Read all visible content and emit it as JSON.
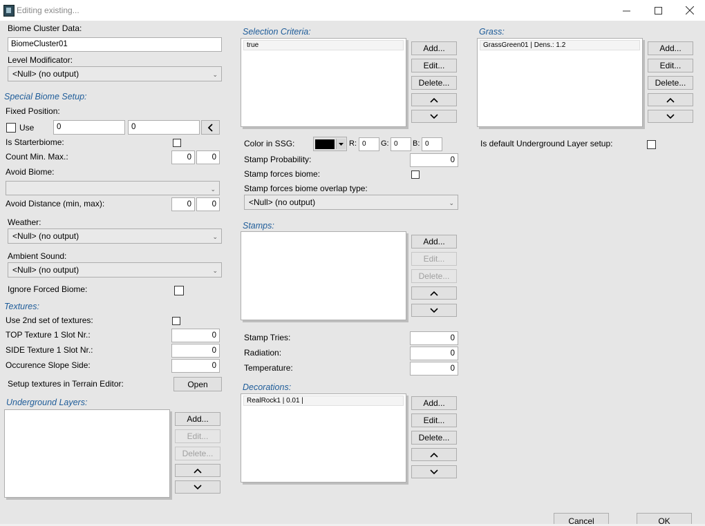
{
  "window": {
    "title": "Editing existing..."
  },
  "left": {
    "cluster_label": "Biome Cluster Data:",
    "cluster_value": "BiomeCluster01",
    "level_mod_label": "Level Modificator:",
    "level_mod_value": "<Null> (no output)",
    "special_header": "Special Biome Setup:",
    "fixed_position_label": "Fixed Position:",
    "use_label": "Use",
    "pos_x": "0",
    "pos_y": "0",
    "starter_label": "Is Starterbiome:",
    "count_label": "Count Min. Max.:",
    "count_min": "0",
    "count_max": "0",
    "avoid_biome_label": "Avoid Biome:",
    "avoid_biome_value": "",
    "avoid_dist_label": "Avoid Distance (min, max):",
    "avoid_min": "0",
    "avoid_max": "0",
    "weather_label": "Weather:",
    "weather_value": "<Null> (no output)",
    "ambient_label": "Ambient Sound:",
    "ambient_value": "<Null> (no output)",
    "ignore_forced_label": "Ignore Forced Biome:",
    "textures_header": "Textures:",
    "second_set_label": "Use 2nd set of textures:",
    "top_tex_label": "TOP Texture 1 Slot Nr.:",
    "top_tex_value": "0",
    "side_tex_label": "SIDE Texture 1 Slot Nr.:",
    "side_tex_value": "0",
    "slope_label": "Occurence Slope Side:",
    "slope_value": "0",
    "setup_tex_label": "Setup textures in Terrain Editor:",
    "open_label": "Open",
    "underground_header": "Underground Layers:"
  },
  "middle": {
    "selection_header": "Selection Criteria:",
    "selection_items": [
      "true"
    ],
    "color_label": "Color in SSG:",
    "color_value": "#000000",
    "r_label": "R:",
    "r_value": "0",
    "g_label": "G:",
    "g_value": "0",
    "b_label": "B:",
    "b_value": "0",
    "stamp_prob_label": "Stamp Probability:",
    "stamp_prob_value": "0",
    "stamp_forces_label": "Stamp forces biome:",
    "overlap_label": "Stamp forces biome overlap type:",
    "overlap_value": "<Null> (no output)",
    "stamps_header": "Stamps:",
    "stamp_tries_label": "Stamp Tries:",
    "stamp_tries_value": "0",
    "radiation_label": "Radiation:",
    "radiation_value": "0",
    "temperature_label": "Temperature:",
    "temperature_value": "0",
    "decorations_header": "Decorations:",
    "decoration_items": [
      "RealRock1 | 0.01 |"
    ]
  },
  "right": {
    "grass_header": "Grass:",
    "grass_items": [
      "GrassGreen01 | Dens.: 1.2"
    ],
    "default_ug_label": "Is default Underground Layer setup:"
  },
  "buttons": {
    "add": "Add...",
    "edit": "Edit...",
    "delete": "Delete...",
    "cancel": "Cancel",
    "ok": "OK"
  },
  "icons": {
    "minimize": "minimize-icon",
    "maximize": "maximize-icon",
    "close": "close-icon",
    "up": "chevron-up-icon",
    "down": "chevron-down-icon",
    "back": "chevron-left-icon"
  }
}
